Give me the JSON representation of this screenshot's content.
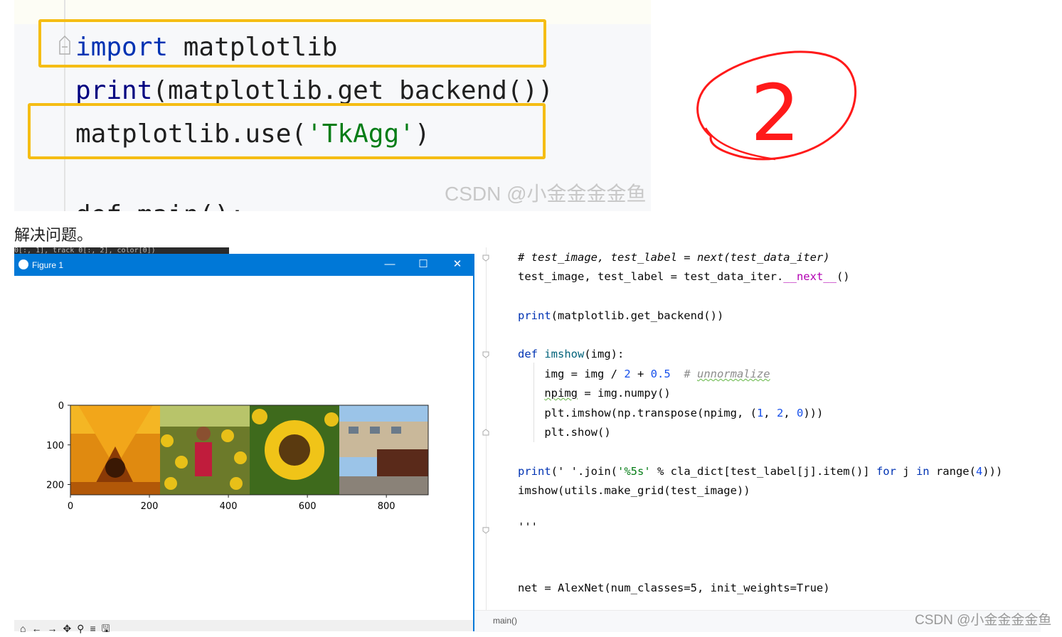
{
  "top_code": {
    "line1_kw": "import",
    "line1_rest": " matplotlib",
    "line2_kw": "print",
    "line2_rest": "(matplotlib.get_backend())",
    "line3_a": "matplotlib.use(",
    "line3_str": "'TkAgg'",
    "line3_b": ")",
    "line4_partial": "def main():"
  },
  "annotation_number": "2",
  "watermark_top": "CSDN @小金金金金鱼",
  "caption": "解决问题。",
  "bg_strip_text": "0[:, 1], track_0[:, 2], color[0])",
  "figure_window": {
    "title": "Figure 1",
    "minimize_glyph": "—",
    "maximize_glyph": "☐",
    "close_glyph": "✕",
    "toolbar_icons": [
      "home-icon",
      "back-icon",
      "forward-icon",
      "pan-icon",
      "zoom-icon",
      "configure-icon",
      "save-icon"
    ],
    "toolbar_glyphs": "⌂←→✥⚲≡🖫"
  },
  "chart_data": {
    "type": "image",
    "x_ticks": [
      0,
      200,
      400,
      600,
      800
    ],
    "y_ticks": [
      0,
      100,
      200
    ],
    "xlim": [
      0,
      906
    ],
    "ylim": [
      226,
      0
    ],
    "panels": [
      "flower-closeup",
      "woman-in-sunflowers",
      "sunflower",
      "street-trolley"
    ]
  },
  "ide": {
    "c1": "# test_image, test_label = next(test_data_iter)",
    "l2a": "test_image, test_label = test_data_iter.",
    "l2b": "__next__",
    "l2c": "()",
    "l3a": "print",
    "l3b": "(matplotlib.get_backend())",
    "l4a": "def ",
    "l4b": "imshow",
    "l4c": "(img):",
    "l5a": "    img = img / ",
    "l5b": "2",
    "l5c": " + ",
    "l5d": "0.5",
    "l5e": "  # ",
    "l5f": "unnormalize",
    "l6a": "    ",
    "l6b": "npimg",
    "l6c": " = img.numpy()",
    "l7a": "    plt.imshow(np.transpose(npimg, (",
    "l7b": "1",
    "l7c": ", ",
    "l7d": "2",
    "l7e": ", ",
    "l7f": "0",
    "l7g": ")))",
    "l8": "    plt.show()",
    "l9a": "print",
    "l9b": "(' '.join(",
    "l9c": "'%5s'",
    "l9d": " % cla_dict[test_label[j].item()] ",
    "l9e": "for",
    "l9f": " j ",
    "l9g": "in",
    "l9h": " range(",
    "l9i": "4",
    "l9j": ")))",
    "l10": "imshow(utils.make_grid(test_image))",
    "l11": "'''",
    "l12": "net = AlexNet(num_classes=5, init_weights=True)",
    "status": "main()"
  },
  "watermark_bottom": "CSDN @小金金金金鱼",
  "colors": {
    "highlight_box": "#f5bd14",
    "annotation_red": "#ff1a1a",
    "titlebar_blue": "#0078d7"
  }
}
